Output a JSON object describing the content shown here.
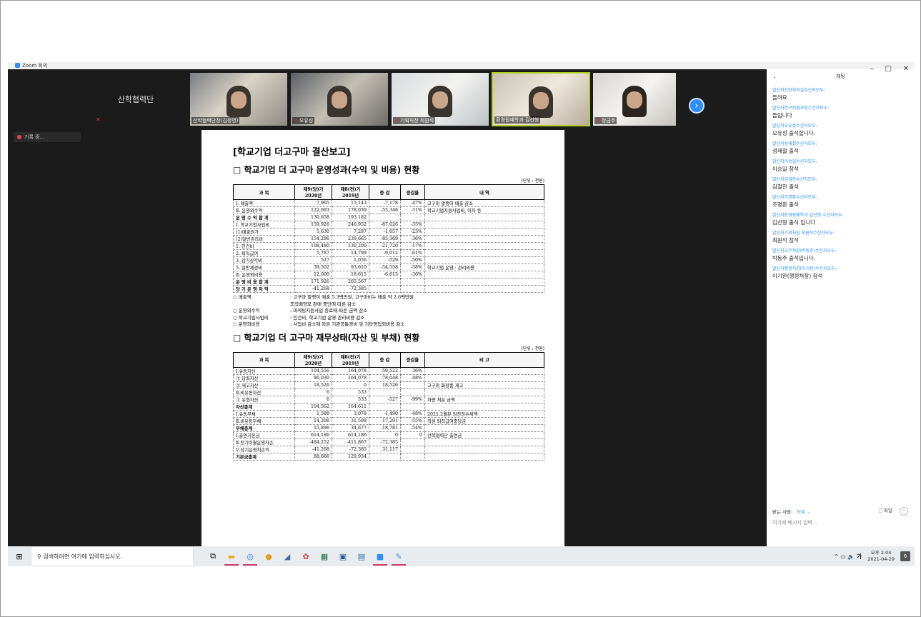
{
  "window": {
    "title": "Zoom 회의"
  },
  "recording": {
    "label": "기록 중..."
  },
  "gallery": {
    "name_only_tile": "산학협력단",
    "tiles": [
      {
        "label": "산학협력단장(김정영)"
      },
      {
        "label": "오유성"
      },
      {
        "label": "기획처장 최원석"
      },
      {
        "label": "환경원예학과 김선형"
      },
      {
        "label": "장금주"
      }
    ]
  },
  "document": {
    "title": "[학교기업 더고구마 결산보고]",
    "section1": {
      "title": "□ 학교기업 더 고구마 운영성과(수익 및 비용) 현황",
      "unit": "(단위 : 천원)",
      "headers": [
        "과 목",
        "제9(당)기 2020년",
        "제8(전)기 2019년",
        "증 감",
        "증감율",
        "내 역"
      ],
      "rows": [
        [
          "Ⅰ. 매출액",
          "7,965",
          "15,143",
          "-7,178",
          "-47%",
          "고구마 말랭이 매출 감소"
        ],
        [
          "Ⅱ. 운영외수익",
          "122,693",
          "178,039",
          "-55,346",
          "-31%",
          "학교기업지원사업비, 이자 등"
        ],
        [
          "운 영 수 익 합 계",
          "130,658",
          "193,182",
          "",
          "",
          ""
        ],
        [
          "Ⅰ. 학교기업사업비",
          "159,926",
          "246,952",
          "-87,026",
          "-35%",
          ""
        ],
        [
          "(1)매출원가",
          "5,630",
          "7,287",
          "-1,657",
          "-23%",
          ""
        ],
        [
          "(2)일반관리비",
          "154,296",
          "239,665",
          "-85,369",
          "-36%",
          ""
        ],
        [
          "1. 인건비",
          "108,480",
          "130,200",
          "-21,720",
          "-17%",
          ""
        ],
        [
          "2. 퇴직급여",
          "5,787",
          "14,799",
          "-9,012",
          "-61%",
          ""
        ],
        [
          "3. 감가상각비",
          "527",
          "1,056",
          "-529",
          "-50%",
          ""
        ],
        [
          "5. 일반제경비",
          "39,502",
          "93,610",
          "-54,558",
          "-58%",
          "학교기업 운영 · 관리비용"
        ],
        [
          "Ⅱ. 운영외비용",
          "12,000",
          "18,615",
          "-6,615",
          "-36%",
          ""
        ],
        [
          "운 영 비 용 합 계",
          "171,926",
          "265,567",
          "",
          "",
          ""
        ],
        [
          "당 기 운 영 차 익",
          "-41,268",
          "-72,385",
          "",
          "",
          ""
        ]
      ],
      "notes": [
        {
          "k": "○ 매출액",
          "v": ": 고구마 말랭이 매출 5.3백만원, 고구마비누 매출 약 2.6백만원"
        },
        {
          "k": "",
          "v": "조직배양묘 판매 중단에 따른 감소"
        },
        {
          "k": "○ 운영외수익",
          "v": ": 마케팅지원사업 종료에 따른 금액 감소"
        },
        {
          "k": "○ 학교기업사업비",
          "v": ": 인건비, 학교기업 운영 관리비용 감소"
        },
        {
          "k": "○ 운영외비용",
          "v": ": 사업비 감소에 따른 기관공통경비 및 기타영업외비용 감소"
        }
      ]
    },
    "section2": {
      "title": "□ 학교기업 더 고구마 재무상태(자산 및 부채) 현황",
      "unit": "(단위 : 천원)",
      "headers": [
        "과 목",
        "제9(당)기 2020년",
        "제8(전)기 2019년",
        "증 감",
        "증감율",
        "비 고"
      ],
      "rows": [
        [
          "Ⅰ.유동자산",
          "104,556",
          "164,078",
          "-59,522",
          "-36%",
          ""
        ],
        [
          "① 당좌자산",
          "86,030",
          "164,078",
          "-78,048",
          "-48%",
          ""
        ],
        [
          "② 재고자산",
          "18,526",
          "0",
          "18,526",
          "",
          "고구마 화장품 재고"
        ],
        [
          "Ⅱ.비유동자산",
          "6",
          "533",
          "",
          "",
          ""
        ],
        [
          "① 유형자산",
          "6",
          "533",
          "-527",
          "-99%",
          "차량 처분 금액"
        ],
        [
          "자산총계",
          "104,562",
          "164,611",
          "",
          "",
          ""
        ],
        [
          "Ⅰ.유동부채",
          "1,588",
          "3,078",
          "-1,490",
          "-48%",
          "2021.2월분 원천징수세액"
        ],
        [
          "Ⅱ.비유동부채",
          "14,308",
          "31,599",
          "-17,291",
          "-55%",
          "직원 퇴직급여충당금"
        ],
        [
          "부채총계",
          "15,896",
          "34,677",
          "-18,781",
          "-54%",
          ""
        ],
        [
          "Ⅰ.출연기본금",
          "614,186",
          "614,186",
          "0",
          "0",
          "산학협력단 출연금"
        ],
        [
          "Ⅱ.전기이월운영차손",
          "-484,252",
          "-411,867",
          "-72,385",
          "",
          ""
        ],
        [
          "Ⅴ.당기운영차손익",
          "-41,268",
          "-72,385",
          "31,117",
          "",
          ""
        ],
        [
          "기본금총계",
          "88,666",
          "129,934",
          "",
          "",
          ""
        ]
      ]
    }
  },
  "chat": {
    "title": "채팅",
    "messages": [
      {
        "from": "발신자산단회의실수신자모두:",
        "text": "들려요"
      },
      {
        "from": "발신자연구지원과장수신자모두:",
        "text": "들립니다"
      },
      {
        "from": "발신자오유성수신자모두:",
        "text": "오유성 출석합니다."
      },
      {
        "from": "발신자성재철수신자모두:",
        "text": "성재철 출석"
      },
      {
        "from": "발신자이승일수신자모두:",
        "text": "이승일 참석"
      },
      {
        "from": "발신자김철한수신자모두:",
        "text": "김철한 출석"
      },
      {
        "from": "발신자조명환수신자모두:",
        "text": "조명환 출석"
      },
      {
        "from": "발신자환경원예학과 김선형 수신자모두:",
        "text": "김선형 출석 입니다"
      },
      {
        "from": "발신자기획처장 최원석수신자모두:",
        "text": "최원석 참석"
      },
      {
        "from": "발신자교무처장(박동주)수신자모두:",
        "text": "박동주 출석입니다."
      },
      {
        "from": "발신자행정처장(이기완)수신자모두:",
        "text": "이기완(행정처장) 참석"
      }
    ],
    "to_label": "받는 사람:",
    "to_value": "모두 ⌄",
    "file_label": "파일",
    "input_placeholder": "여기에 메시지 입력..."
  },
  "taskbar": {
    "search_placeholder": "검색하려면 여기에 입력하십시오.",
    "time": "오후 2:04",
    "date": "2021-04-29",
    "ime": "가",
    "notification_count": "6"
  }
}
